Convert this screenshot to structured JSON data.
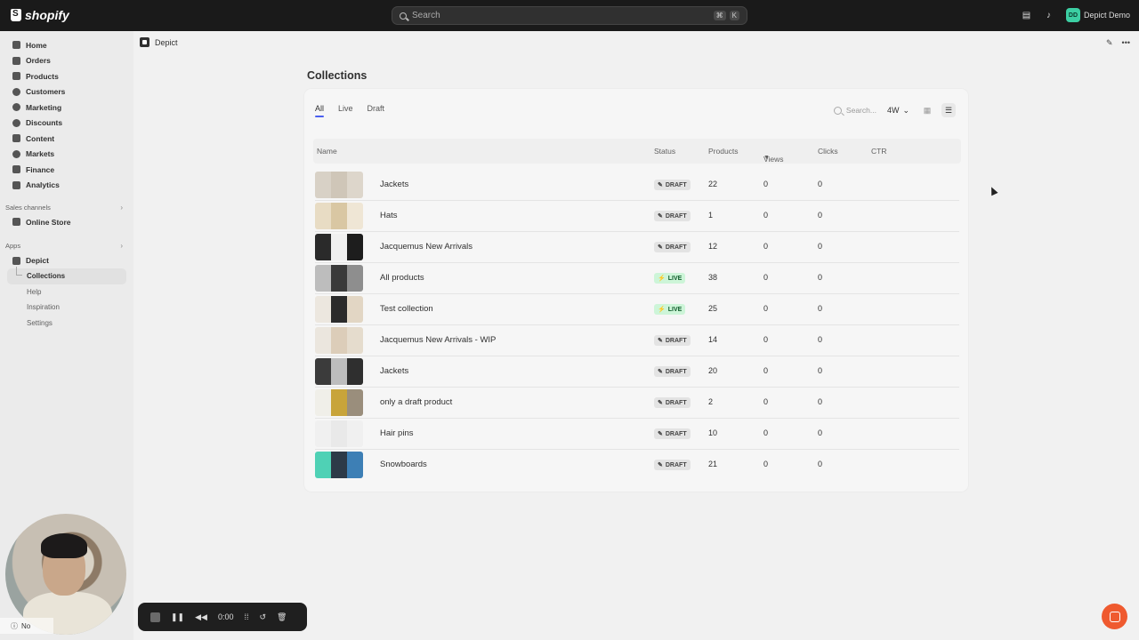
{
  "topbar": {
    "brand": "shopify",
    "search_placeholder": "Search",
    "shortcut_keys": [
      "⌘",
      "K"
    ],
    "account_initials": "DD",
    "account_name": "Depict Demo"
  },
  "sidebar": {
    "items": [
      {
        "label": "Home",
        "icon": "home-icon"
      },
      {
        "label": "Orders",
        "icon": "orders-icon"
      },
      {
        "label": "Products",
        "icon": "tag-icon"
      },
      {
        "label": "Customers",
        "icon": "person-icon"
      },
      {
        "label": "Marketing",
        "icon": "target-icon"
      },
      {
        "label": "Discounts",
        "icon": "discount-icon"
      },
      {
        "label": "Content",
        "icon": "content-icon"
      },
      {
        "label": "Markets",
        "icon": "globe-icon"
      },
      {
        "label": "Finance",
        "icon": "bank-icon"
      },
      {
        "label": "Analytics",
        "icon": "chart-icon"
      }
    ],
    "sales_channels_label": "Sales channels",
    "online_store_label": "Online Store",
    "apps_label": "Apps",
    "app_name": "Depict",
    "app_subitems": [
      "Collections",
      "Help",
      "Inspiration",
      "Settings"
    ]
  },
  "breadcrumb": {
    "app": "Depict"
  },
  "page": {
    "title": "Collections"
  },
  "tabs": [
    "All",
    "Live",
    "Draft"
  ],
  "toolbar": {
    "search_placeholder": "Search...",
    "range": "4W"
  },
  "table": {
    "headers": {
      "name": "Name",
      "status": "Status",
      "products": "Products",
      "views": "Views",
      "clicks": "Clicks",
      "ctr": "CTR"
    },
    "rows": [
      {
        "name": "Jackets",
        "status": "DRAFT",
        "products": "22",
        "views": "0",
        "clicks": "0",
        "thumb": [
          "#d8d1c6",
          "#cfc6b8",
          "#ddd6cb"
        ]
      },
      {
        "name": "Hats",
        "status": "DRAFT",
        "products": "1",
        "views": "0",
        "clicks": "0",
        "thumb": [
          "#e8dcc4",
          "#d9c7a3",
          "#efe6d5"
        ]
      },
      {
        "name": "Jacquemus New Arrivals",
        "status": "DRAFT",
        "products": "12",
        "views": "0",
        "clicks": "0",
        "thumb": [
          "#2a2a2a",
          "#f0f0f0",
          "#1d1d1d"
        ]
      },
      {
        "name": "All products",
        "status": "LIVE",
        "products": "38",
        "views": "0",
        "clicks": "0",
        "thumb": [
          "#bdbdbd",
          "#3a3a3a",
          "#8e8e8e"
        ]
      },
      {
        "name": "Test collection",
        "status": "LIVE",
        "products": "25",
        "views": "0",
        "clicks": "0",
        "thumb": [
          "#ece7df",
          "#2b2b2b",
          "#e2d6c4"
        ]
      },
      {
        "name": "Jacquemus New Arrivals - WIP",
        "status": "DRAFT",
        "products": "14",
        "views": "0",
        "clicks": "0",
        "thumb": [
          "#ebe6de",
          "#dccdb9",
          "#e5dccd"
        ]
      },
      {
        "name": "Jackets",
        "status": "DRAFT",
        "products": "20",
        "views": "0",
        "clicks": "0",
        "thumb": [
          "#3b3b3b",
          "#bdbdbd",
          "#2f2f2f"
        ]
      },
      {
        "name": "only a draft product",
        "status": "DRAFT",
        "products": "2",
        "views": "0",
        "clicks": "0",
        "thumb": [
          "#f0efe9",
          "#c8a43a",
          "#9a8e7c"
        ]
      },
      {
        "name": "Hair pins",
        "status": "DRAFT",
        "products": "10",
        "views": "0",
        "clicks": "0",
        "thumb": [
          "#f0f0f0",
          "#e9e9e9",
          "#f0f0f0"
        ]
      },
      {
        "name": "Snowboards",
        "status": "DRAFT",
        "products": "21",
        "views": "0",
        "clicks": "0",
        "thumb": [
          "#4fd1b5",
          "#2d3a48",
          "#3d7fb5"
        ]
      }
    ]
  },
  "recorder": {
    "time": "0:00"
  },
  "camera_overlay": {
    "label": "No"
  }
}
